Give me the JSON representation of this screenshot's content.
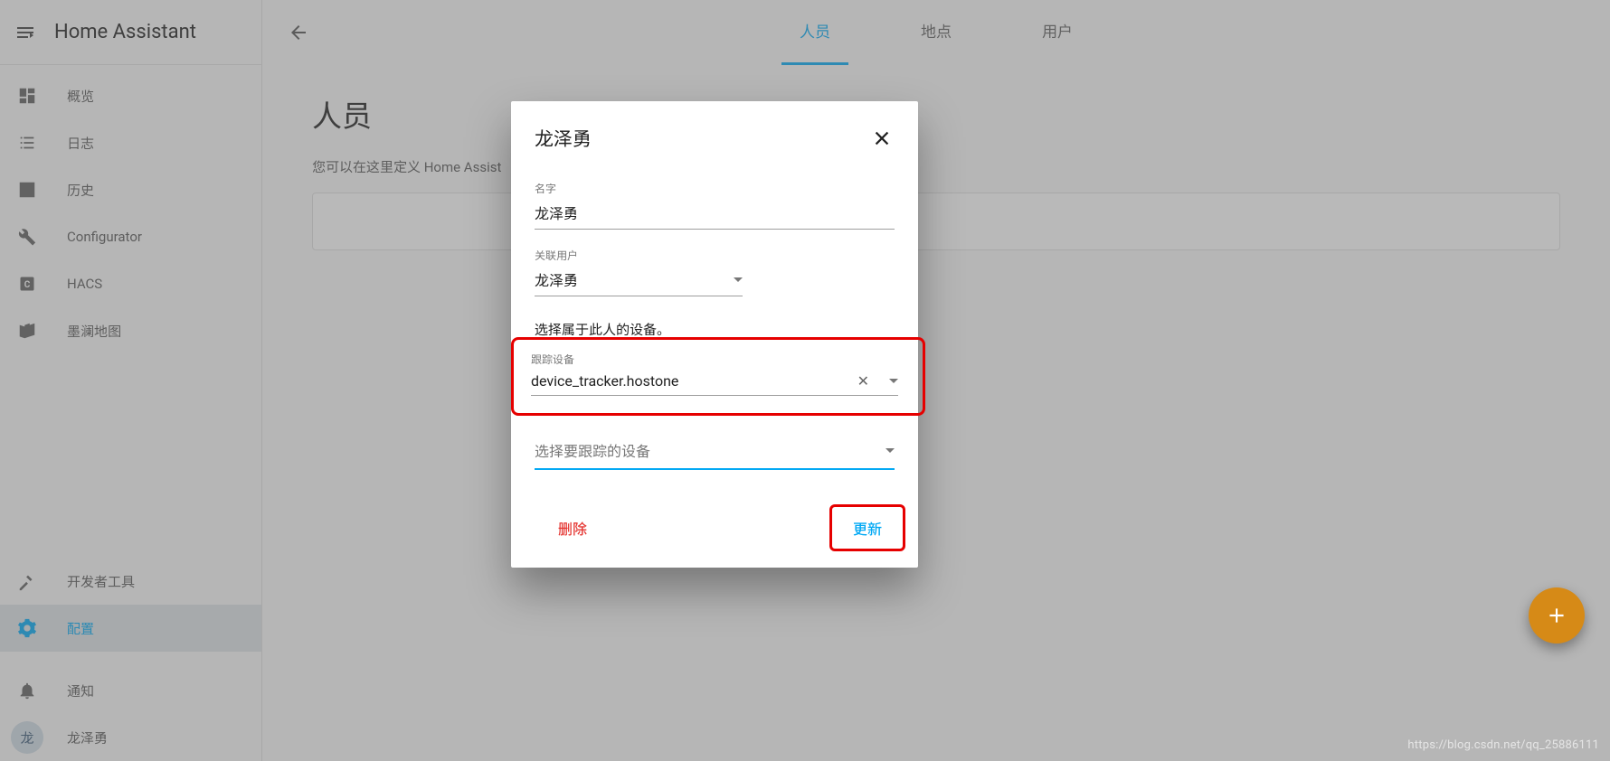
{
  "app": {
    "title": "Home Assistant"
  },
  "sidebar": {
    "items": [
      {
        "label": "概览"
      },
      {
        "label": "日志"
      },
      {
        "label": "历史"
      },
      {
        "label": "Configurator"
      },
      {
        "label": "HACS"
      },
      {
        "label": "墨澜地图"
      }
    ],
    "dev_tools": "开发者工具",
    "config": "配置",
    "notifications": "通知",
    "user_name": "龙泽勇",
    "user_initial": "龙"
  },
  "tabs": [
    {
      "label": "人员",
      "active": true
    },
    {
      "label": "地点",
      "active": false
    },
    {
      "label": "用户",
      "active": false
    }
  ],
  "page": {
    "heading": "人员",
    "description": "您可以在这里定义 Home Assist"
  },
  "dialog": {
    "title": "龙泽勇",
    "name_label": "名字",
    "name_value": "龙泽勇",
    "linked_label": "关联用户",
    "linked_value": "龙泽勇",
    "pick_devices_text": "选择属于此人的设备。",
    "tracker_label": "跟踪设备",
    "tracker_value": "device_tracker.hostone",
    "select_placeholder": "选择要跟踪的设备",
    "delete": "删除",
    "update": "更新"
  },
  "watermark": "https://blog.csdn.net/qq_25886111"
}
